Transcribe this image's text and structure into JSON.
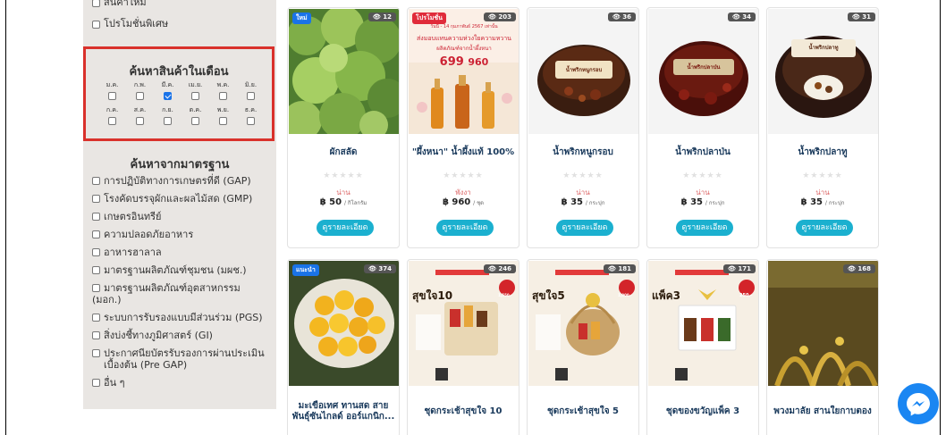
{
  "sidebar": {
    "top_items": [
      "สินค้าใหม่",
      "โปรโมชั่นพิเศษ"
    ],
    "month_search": {
      "title": "ค้นหาสินค้าในเดือน",
      "row1": [
        {
          "label": "ม.ค.",
          "checked": false
        },
        {
          "label": "ก.พ.",
          "checked": false
        },
        {
          "label": "มี.ค.",
          "checked": true
        },
        {
          "label": "เม.ย.",
          "checked": false
        },
        {
          "label": "พ.ค.",
          "checked": false
        },
        {
          "label": "มิ.ย.",
          "checked": false
        }
      ],
      "row2": [
        {
          "label": "ก.ค.",
          "checked": false
        },
        {
          "label": "ส.ค.",
          "checked": false
        },
        {
          "label": "ก.ย.",
          "checked": false
        },
        {
          "label": "ต.ค.",
          "checked": false
        },
        {
          "label": "พ.ย.",
          "checked": false
        },
        {
          "label": "ธ.ค.",
          "checked": false
        }
      ]
    },
    "standards": {
      "title": "ค้นหาจากมาตรฐาน",
      "items": [
        "การปฏิบัติทางการเกษตรที่ดี (GAP)",
        "โรงคัดบรรจุผักและผลไม้สด (GMP)",
        "เกษตรอินทรีย์",
        "ความปลอดภัยอาหาร",
        "อาหารฮาลาล",
        "มาตรฐานผลิตภัณฑ์ชุมชน (มผช.)",
        "มาตรฐานผลิตภัณฑ์อุตสาหกรรม (มอก.)",
        "ระบบการรับรองแบบมีส่วนร่วม (PGS)",
        "สิ่งบ่งชี้ทางภูมิศาสตร์ (GI)",
        "ประกาศนียบัตรรับรองการผ่านประเมิน เบื้องต้น (Pre GAP)",
        "อื่น ๆ"
      ]
    }
  },
  "products_row1": [
    {
      "badge": "ใหม่",
      "badge_color": "#1a73e8",
      "views": "12",
      "name": "ผักสลัด",
      "seller": "น่าน",
      "price": "฿ 50",
      "unit": "/ กิโลกรัม",
      "button": "ดูรายละเอียด",
      "img_bg": "#5c8a3a"
    },
    {
      "badge": "โปรโมชั่น",
      "badge_color": "#e02b3a",
      "views": "203",
      "name": "\"ผึ้งหนา\" น้ำผึ้งแท้ 100%",
      "seller": "พังงา",
      "price": "฿ 960",
      "unit": "/ ชุด",
      "button": "ดูรายละเอียด",
      "img_bg": "#f4e4d0",
      "promo_line1": "วันนี้ - 14 กุมภาพันธ์ 2567 เท่านั้น",
      "promo_line2": "ส่งมอบแทนความห่วงใยความหวาน",
      "promo_line3": "ผลิตภัณฑ์จากน้ำผึ้งหนา",
      "promo_price": "699",
      "promo_old": "960"
    },
    {
      "badge": "",
      "badge_color": "",
      "views": "36",
      "name": "น้ำพริกหนูกรอบ",
      "seller": "น่าน",
      "price": "฿ 35",
      "unit": "/ กระปุก",
      "button": "ดูรายละเอียด",
      "img_bg": "#f2f2f2",
      "label_text": "น้ำพริกหนูกรอบ"
    },
    {
      "badge": "",
      "badge_color": "",
      "views": "34",
      "name": "น้ำพริกปลาป่น",
      "seller": "น่าน",
      "price": "฿ 35",
      "unit": "/ กระปุก",
      "button": "ดูรายละเอียด",
      "img_bg": "#f2f2f2",
      "label_text": "น้ำพริกปลาป่น"
    },
    {
      "badge": "",
      "badge_color": "",
      "views": "31",
      "name": "น้ำพริกปลาทู",
      "seller": "น่าน",
      "price": "฿ 35",
      "unit": "/ กระปุก",
      "button": "ดูรายละเอียด",
      "img_bg": "#f2f2f2",
      "label_text": "น้ำพริกปลาทู"
    }
  ],
  "products_row2": [
    {
      "badge": "แนะนำ",
      "badge_color": "#1a73e8",
      "views": "374",
      "name": "มะเขือเทศ ทานสด สาย พันธุ์ซันไกลด์ ออร์แกนิก...",
      "img_bg": "#3a4a2a",
      "gift_title": "",
      "gift_price": ""
    },
    {
      "badge": "",
      "badge_color": "",
      "views": "246",
      "name": "ชุดกระเช้าสุขใจ 10",
      "img_bg": "#f6efe4",
      "gift_title": "สุขใจ10",
      "gift_price": "1,550.-"
    },
    {
      "badge": "",
      "badge_color": "",
      "views": "181",
      "name": "ชุดกระเช้าสุขใจ 5",
      "img_bg": "#f6efe4",
      "gift_title": "สุขใจ5",
      "gift_price": "1,000.-"
    },
    {
      "badge": "",
      "badge_color": "",
      "views": "171",
      "name": "ชุดของขวัญแพ็ค 3",
      "img_bg": "#f6efe4",
      "gift_title": "แพ็ค3",
      "gift_price": "250.-"
    },
    {
      "badge": "",
      "badge_color": "",
      "views": "168",
      "name": "พวงมาลัย สานใยกาบตอง",
      "img_bg": "#6a5a2a",
      "gift_title": "",
      "gift_price": ""
    }
  ],
  "icons": {
    "eye": "eye-icon",
    "star": "star-icon",
    "messenger": "messenger-icon"
  },
  "colors": {
    "highlight_border": "#d9312b",
    "button": "#1bb0cf",
    "sidebar_bg": "#e9e6e3",
    "product_name": "#1a3a5c"
  }
}
